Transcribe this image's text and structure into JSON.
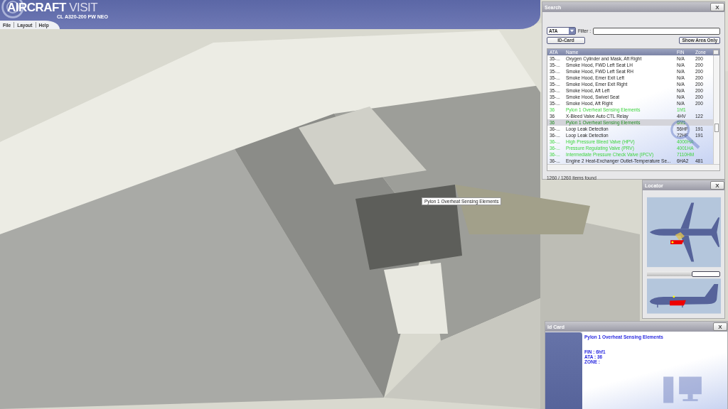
{
  "app": {
    "title_bold": "AIRCRAFT",
    "title_light": "VISIT",
    "subtitle": "CL A320-200 PW NEO"
  },
  "menu": [
    {
      "label": "File"
    },
    {
      "label": "Layout"
    },
    {
      "label": "Help"
    }
  ],
  "tooltip": "Pylon 1 Overheat Sensing Elements",
  "search": {
    "title": "Search",
    "close": "X",
    "dropdown": "ATA",
    "filter_label": "Filter :",
    "id_card_button": "ID-Card",
    "show_area_button": "Show Area Only",
    "columns": [
      "ATA",
      "Name",
      "FIN",
      "Zone"
    ],
    "rows": [
      {
        "ata": "35-...",
        "name": "Oxygen Cylinder and Mask, Aft Right",
        "fin": "N/A",
        "zone": "200",
        "linked": false,
        "selected": false
      },
      {
        "ata": "35-...",
        "name": "Smoke Hood, FWD Left Seat LH",
        "fin": "N/A",
        "zone": "200",
        "linked": false,
        "selected": false
      },
      {
        "ata": "35-...",
        "name": "Smoke Hood, FWD Left Seat RH",
        "fin": "N/A",
        "zone": "200",
        "linked": false,
        "selected": false
      },
      {
        "ata": "35-...",
        "name": "Smoke Hood, Emer Exit Left",
        "fin": "N/A",
        "zone": "200",
        "linked": false,
        "selected": false
      },
      {
        "ata": "35-...",
        "name": "Smoke Hood, Emer Exit Right",
        "fin": "N/A",
        "zone": "200",
        "linked": false,
        "selected": false
      },
      {
        "ata": "35-...",
        "name": "Smoke Hood, Aft Left",
        "fin": "N/A",
        "zone": "200",
        "linked": false,
        "selected": false
      },
      {
        "ata": "35-...",
        "name": "Smoke Hood, Swivel Seat",
        "fin": "N/A",
        "zone": "200",
        "linked": false,
        "selected": false
      },
      {
        "ata": "35-...",
        "name": "Smoke Hood, Aft Right",
        "fin": "N/A",
        "zone": "200",
        "linked": false,
        "selected": false
      },
      {
        "ata": "36",
        "name": "Pylon 1 Overheat Sensing Elements",
        "fin": "1hf1",
        "linked": true,
        "selected": false
      },
      {
        "ata": "36",
        "name": "X-Bleed Valve Auto CTL Relay",
        "fin": "4HV",
        "zone": "122",
        "linked": false,
        "selected": false
      },
      {
        "ata": "36",
        "name": "Pylon 1 Overheat Sensing Elements",
        "fin": "6hf1",
        "linked": true,
        "selected": true
      },
      {
        "ata": "36-...",
        "name": "Loop Leak Detection",
        "fin": "56HF",
        "zone": "191",
        "linked": false,
        "selected": false
      },
      {
        "ata": "36-...",
        "name": "Loop Leak Detection",
        "fin": "72HF",
        "zone": "191",
        "linked": false,
        "selected": false
      },
      {
        "ata": "36-...",
        "name": "High Pressure Bleed Valve (HPV)",
        "fin": "4000HA",
        "linked": true,
        "selected": false
      },
      {
        "ata": "36-...",
        "name": "Pressure Regulating Valve (PRV)",
        "fin": "4001HA",
        "linked": true,
        "selected": false
      },
      {
        "ata": "36-...",
        "name": "Intermediate Pressure Check Valve (IPCV)",
        "fin": "7110HM",
        "linked": true,
        "selected": false
      },
      {
        "ata": "36-...",
        "name": "Engine 2 Heat-Exchanger Outlet-Temperature Se...",
        "fin": "6HA2",
        "zone": "481",
        "linked": false,
        "selected": false
      }
    ],
    "status": "1260 / 1260 items found"
  },
  "locator": {
    "title": "Locator",
    "close": "X"
  },
  "id_card": {
    "title": "Id Card",
    "close": "X",
    "name": "Pylon 1 Overheat Sensing Elements",
    "lines": [
      "FIN : 6hf1",
      "ATA : 36",
      "ZONE :"
    ]
  }
}
